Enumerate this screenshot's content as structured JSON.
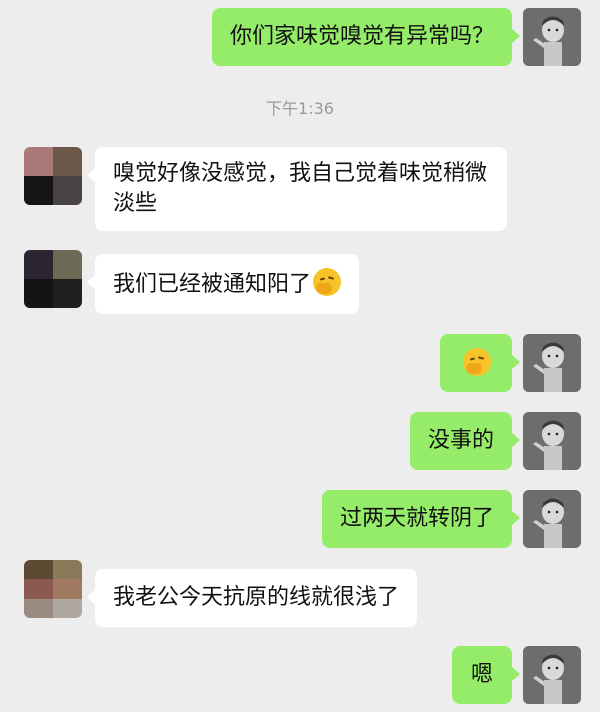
{
  "timestamp": "下午1:36",
  "messages": [
    {
      "dir": "out",
      "text": "你们家味觉嗅觉有异常吗？"
    },
    {
      "dir": "in",
      "text": "嗅觉好像没感觉，我自己觉着味觉稍微淡些"
    },
    {
      "dir": "in",
      "text": "我们已经被通知阳了",
      "emoji": "facepalm-emoji"
    },
    {
      "dir": "out",
      "text": "",
      "emoji": "facepalm-emoji"
    },
    {
      "dir": "out",
      "text": "没事的"
    },
    {
      "dir": "out",
      "text": "过两天就转阴了"
    },
    {
      "dir": "in",
      "text": "我老公今天抗原的线就很浅了"
    },
    {
      "dir": "out",
      "text": "嗯"
    }
  ],
  "colors": {
    "background": "#ededed",
    "outgoing_bubble": "#95ec69",
    "incoming_bubble": "#ffffff",
    "timestamp_text": "#9a9a9a"
  }
}
